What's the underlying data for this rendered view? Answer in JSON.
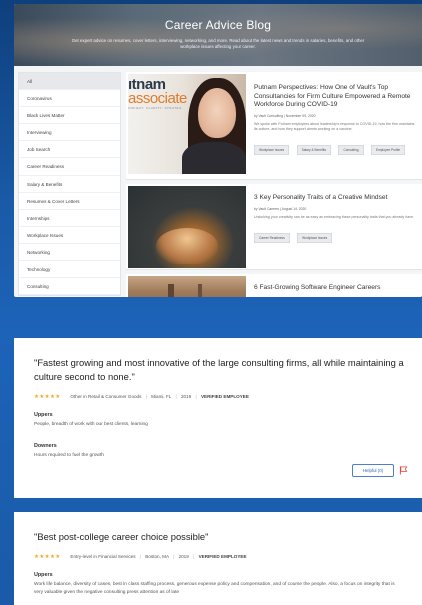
{
  "blog": {
    "title": "Career Advice Blog",
    "subtitle": "Get expert advice on resumes, cover letters, interviewing, networking, and more. Read about the latest news and trends in salaries, benefits, and other workplace issues affecting your career.",
    "categories": [
      "All",
      "Coronavirus",
      "Black Lives Matter",
      "Interviewing",
      "Job Search",
      "Career Readiness",
      "Salary & Benefits",
      "Resumes & Cover Letters",
      "Internships",
      "Workplace Issues",
      "Networking",
      "Technology",
      "Consulting"
    ],
    "articles": [
      {
        "title": "Putnam Perspectives: How One of Vault's Top Consultancies for Firm Culture Empowered a Remote Workforce During COVID-19",
        "meta": "by Vault Consulting | November 09, 2020",
        "excerpt": "We spoke with Putnam employees about leadership's response to COVID-19, how the firm maintains its culture, and how they support clients working on a vaccine.",
        "tags": [
          "Workplace Issues",
          "Salary & Benefits",
          "Consulting",
          "Employee Profile"
        ],
        "image_logo_line1": "ıtnam",
        "image_logo_line2": "associate",
        "image_logo_line3": "INSIGHT. CLARITY. STRATEG"
      },
      {
        "title": "3 Key Personality Traits of a Creative Mindset",
        "meta": "by Vault Careers | August 14, 2020",
        "excerpt": "Unlocking your creativity can be as easy as embracing these personality traits that you already have.",
        "tags": [
          "Career Readiness",
          "Workplace Issues"
        ]
      },
      {
        "title": "6 Fast-Growing Software Engineer Careers"
      }
    ]
  },
  "reviews": [
    {
      "title": "\"Fastest growing and most innovative of the large consulting firms, all while maintaining a culture second to none.\"",
      "stars": "★★★★★",
      "role": "Other in Retail & Consumer Goods",
      "location": "Miami, FL",
      "year": "2019",
      "verified": "VERIFIED EMPLOYEE",
      "uppers_label": "Uppers",
      "uppers_text": "People, breadth of work with our best clients, learning",
      "downers_label": "Downers",
      "downers_text": "Hours required to fuel the growth",
      "helpful_label": "Helpful (0)"
    },
    {
      "title": "\"Best post-college career choice possible\"",
      "stars": "★★★★★",
      "role": "Entry-level in Financial Services",
      "location": "Boston, MA",
      "year": "2019",
      "verified": "VERIFIED EMPLOYEE",
      "uppers_label": "Uppers",
      "uppers_text": "Work life balance, diversity of cases, best in class staffing process, generous expense policy and compensation, and of course the people. Also, a focus on integrity that is very valuable given the negative consulting press attention as of late"
    }
  ],
  "colors": {
    "star": "#f4a81b",
    "helpful": "#2f66bd",
    "flag": "#e0443a",
    "background": "#1a5aa8"
  },
  "icons": {
    "flag": "flag-icon",
    "star": "star-icon"
  }
}
